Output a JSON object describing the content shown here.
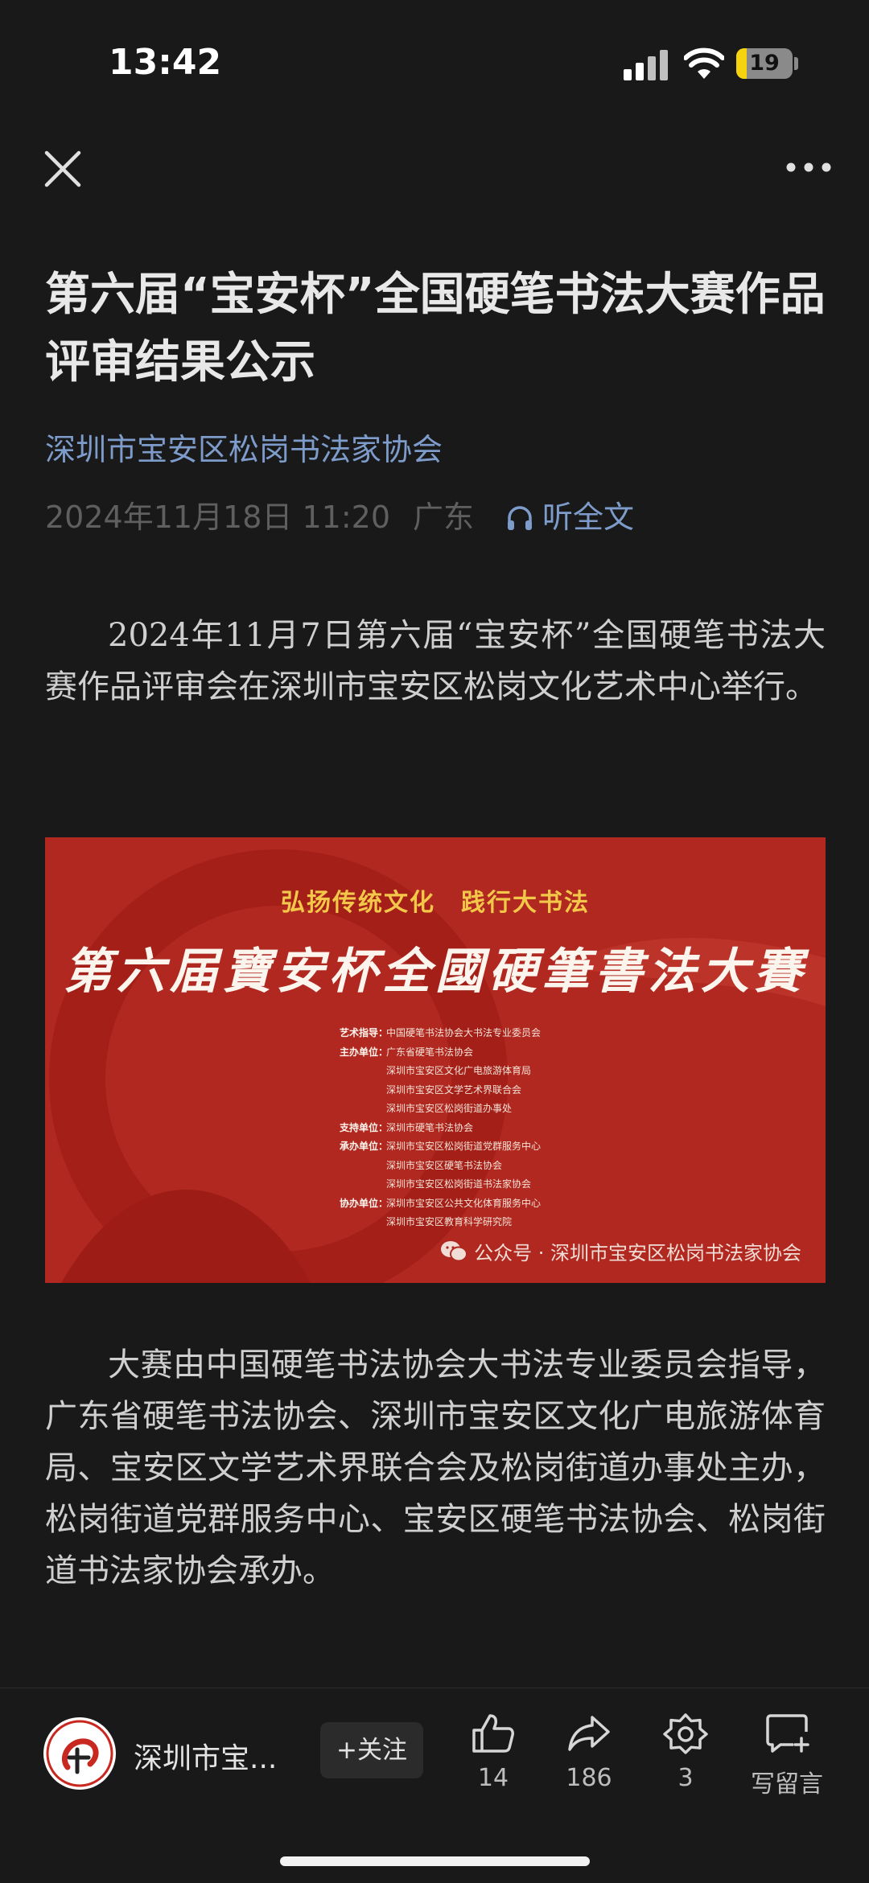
{
  "status_bar": {
    "time": "13:42",
    "battery_level": "19",
    "icons": [
      "signal-icon",
      "wifi-icon",
      "battery-icon"
    ],
    "battery_color": "#f5d40f"
  },
  "nav": {
    "close_icon": "close-icon",
    "more_icon": "more-icon"
  },
  "article": {
    "title": "第六届“宝安杯”全国硬笔书法大赛作品评审结果公示",
    "account_name": "深圳市宝安区松岗书法家协会",
    "date": "2024年11月18日 11:20",
    "location": "广东",
    "listen_label": "听全文",
    "paragraph_1": "2024年11月7日第六届“宝安杯”全国硬笔书法大赛作品评审会在深圳市宝安区松岗文化艺术中心举行。",
    "paragraph_2": "大赛由中国硬笔书法协会大书法专业委员会指导，广东省硬笔书法协会、深圳市宝安区文化广电旅游体育局、宝安区文学艺术界联合会及松岗街道办事处主办，松岗街道党群服务中心、宝安区硬笔书法协会、松岗街道书法家协会承办。"
  },
  "banner": {
    "slogan": "弘扬传统文化　践行大书法",
    "heading": "第六届寶安杯全國硬筆書法大賽",
    "background_color": "#b12820",
    "rows": [
      {
        "role": "艺术指导：",
        "org": "中国硬笔书法协会大书法专业委员会"
      },
      {
        "role": "主办单位：",
        "org": "广东省硬笔书法协会"
      },
      {
        "role": "",
        "org": "深圳市宝安区文化广电旅游体育局"
      },
      {
        "role": "",
        "org": "深圳市宝安区文学艺术界联合会"
      },
      {
        "role": "",
        "org": "深圳市宝安区松岗街道办事处"
      },
      {
        "role": "支持单位：",
        "org": "深圳市硬笔书法协会"
      },
      {
        "role": "承办单位：",
        "org": "深圳市宝安区松岗街道党群服务中心"
      },
      {
        "role": "",
        "org": "深圳市宝安区硬笔书法协会"
      },
      {
        "role": "",
        "org": "深圳市宝安区松岗街道书法家协会"
      },
      {
        "role": "协办单位：",
        "org": "深圳市宝安区公共文化体育服务中心"
      },
      {
        "role": "",
        "org": "深圳市宝安区教育科学研究院"
      }
    ],
    "watermark": "公众号 · 深圳市宝安区松岗书法家协会"
  },
  "bottom_bar": {
    "account_short": "深圳市宝...",
    "follow_label": "+关注",
    "like_count": "14",
    "share_count": "186",
    "recommend_count": "3",
    "comment_label": "写留言"
  }
}
